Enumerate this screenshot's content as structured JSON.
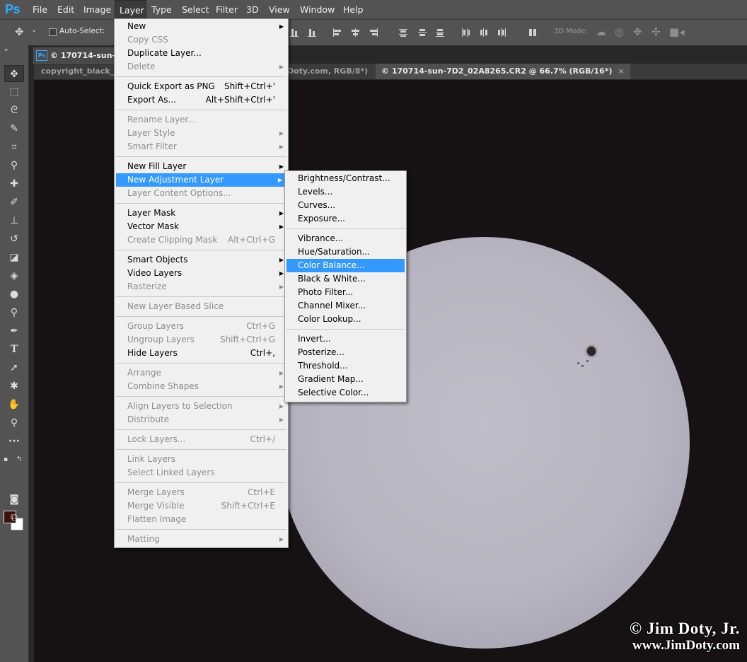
{
  "app": {
    "logo": "Ps"
  },
  "menubar": [
    {
      "label": "File"
    },
    {
      "label": "Edit"
    },
    {
      "label": "Image"
    },
    {
      "label": "Layer"
    },
    {
      "label": "Type"
    },
    {
      "label": "Select"
    },
    {
      "label": "Filter"
    },
    {
      "label": "3D"
    },
    {
      "label": "View"
    },
    {
      "label": "Window"
    },
    {
      "label": "Help"
    }
  ],
  "options": {
    "auto_select_label": "Auto-Select:",
    "mode_3d_label": "3D Mode:"
  },
  "float_window": {
    "title": "© 170714-sun-7D2"
  },
  "tabs": [
    {
      "label": "copyright_black_on"
    },
    {
      "label": "Doty.com, RGB/8*)",
      "close": "×"
    },
    {
      "label": "© 170714-sun-7D2_02A8265.CR2 @ 66.7% (RGB/16*)",
      "close": "×"
    }
  ],
  "layer_menu": [
    {
      "label": "New",
      "submenu": true
    },
    {
      "label": "Copy CSS",
      "disabled": true
    },
    {
      "label": "Duplicate Layer..."
    },
    {
      "label": "Delete",
      "disabled": true,
      "submenu": true
    },
    {
      "sep": true
    },
    {
      "label": "Quick Export as PNG",
      "shortcut": "Shift+Ctrl+'"
    },
    {
      "label": "Export As...",
      "shortcut": "Alt+Shift+Ctrl+'"
    },
    {
      "sep": true
    },
    {
      "label": "Rename Layer...",
      "disabled": true
    },
    {
      "label": "Layer Style",
      "disabled": true,
      "submenu": true
    },
    {
      "label": "Smart Filter",
      "disabled": true,
      "submenu": true
    },
    {
      "sep": true
    },
    {
      "label": "New Fill Layer",
      "submenu": true
    },
    {
      "label": "New Adjustment Layer",
      "submenu": true,
      "highlight": true
    },
    {
      "label": "Layer Content Options...",
      "disabled": true
    },
    {
      "sep": true
    },
    {
      "label": "Layer Mask",
      "submenu": true
    },
    {
      "label": "Vector Mask",
      "submenu": true
    },
    {
      "label": "Create Clipping Mask",
      "disabled": true,
      "shortcut": "Alt+Ctrl+G"
    },
    {
      "sep": true
    },
    {
      "label": "Smart Objects",
      "submenu": true
    },
    {
      "label": "Video Layers",
      "submenu": true
    },
    {
      "label": "Rasterize",
      "disabled": true,
      "submenu": true
    },
    {
      "sep": true
    },
    {
      "label": "New Layer Based Slice",
      "disabled": true
    },
    {
      "sep": true
    },
    {
      "label": "Group Layers",
      "disabled": true,
      "shortcut": "Ctrl+G"
    },
    {
      "label": "Ungroup Layers",
      "disabled": true,
      "shortcut": "Shift+Ctrl+G"
    },
    {
      "label": "Hide Layers",
      "shortcut": "Ctrl+,"
    },
    {
      "sep": true
    },
    {
      "label": "Arrange",
      "disabled": true,
      "submenu": true
    },
    {
      "label": "Combine Shapes",
      "disabled": true,
      "submenu": true
    },
    {
      "sep": true
    },
    {
      "label": "Align Layers to Selection",
      "disabled": true,
      "submenu": true
    },
    {
      "label": "Distribute",
      "disabled": true,
      "submenu": true
    },
    {
      "sep": true
    },
    {
      "label": "Lock Layers...",
      "disabled": true,
      "shortcut": "Ctrl+/"
    },
    {
      "sep": true
    },
    {
      "label": "Link Layers",
      "disabled": true
    },
    {
      "label": "Select Linked Layers",
      "disabled": true
    },
    {
      "sep": true
    },
    {
      "label": "Merge Layers",
      "disabled": true,
      "shortcut": "Ctrl+E"
    },
    {
      "label": "Merge Visible",
      "disabled": true,
      "shortcut": "Shift+Ctrl+E"
    },
    {
      "label": "Flatten Image",
      "disabled": true
    },
    {
      "sep": true
    },
    {
      "label": "Matting",
      "disabled": true,
      "submenu": true
    }
  ],
  "adjustment_submenu": [
    {
      "label": "Brightness/Contrast..."
    },
    {
      "label": "Levels..."
    },
    {
      "label": "Curves..."
    },
    {
      "label": "Exposure..."
    },
    {
      "sep": true
    },
    {
      "label": "Vibrance..."
    },
    {
      "label": "Hue/Saturation..."
    },
    {
      "label": "Color Balance...",
      "highlight": true
    },
    {
      "label": "Black & White..."
    },
    {
      "label": "Photo Filter..."
    },
    {
      "label": "Channel Mixer..."
    },
    {
      "label": "Color Lookup..."
    },
    {
      "sep": true
    },
    {
      "label": "Invert..."
    },
    {
      "label": "Posterize..."
    },
    {
      "label": "Threshold..."
    },
    {
      "label": "Gradient Map..."
    },
    {
      "label": "Selective Color..."
    }
  ],
  "watermark": {
    "line1": "© Jim Doty, Jr.",
    "line2": "www.JimDoty.com"
  },
  "colors": {
    "accent": "#3399ff",
    "menu_bg": "#f0f0f0",
    "ps_blue": "#31a8ff",
    "foreground_swatch": "#3a1208",
    "background_swatch": "#ffffff"
  },
  "icons": {
    "tools": [
      "move-tool-icon",
      "marquee-tool-icon",
      "lasso-tool-icon",
      "quick-select-tool-icon",
      "crop-tool-icon",
      "eyedropper-tool-icon",
      "healing-brush-tool-icon",
      "brush-tool-icon",
      "clone-stamp-tool-icon",
      "history-brush-tool-icon",
      "eraser-tool-icon",
      "paint-bucket-tool-icon",
      "blur-tool-icon",
      "dodge-tool-icon",
      "pen-tool-icon",
      "type-tool-icon",
      "path-select-tool-icon",
      "custom-shape-tool-icon",
      "hand-tool-icon",
      "zoom-tool-icon",
      "more-tools-icon",
      "quick-mask-icon",
      "screen-mode-icon"
    ]
  }
}
